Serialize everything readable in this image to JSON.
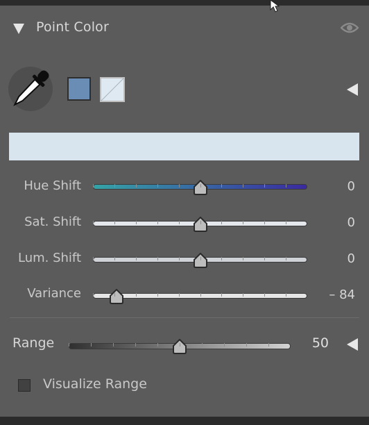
{
  "panel": {
    "title": "Point Color",
    "collapse_icon": "triangle-down-icon",
    "visibility_icon": "eye-icon"
  },
  "swatches": {
    "primary_color": "#6a8db5",
    "secondary_color": "#dfe9f1",
    "selected_color_bar": "#d9e5ee"
  },
  "sliders": [
    {
      "label": "Hue Shift",
      "value": "0",
      "fraction": 0.5,
      "track": "hue"
    },
    {
      "label": "Sat. Shift",
      "value": "0",
      "fraction": 0.5,
      "track": "sat"
    },
    {
      "label": "Lum. Shift",
      "value": "0",
      "fraction": 0.5,
      "track": "lum"
    },
    {
      "label": "Variance",
      "value": "– 84",
      "fraction": 0.11,
      "track": "var"
    }
  ],
  "range": {
    "label": "Range",
    "value": "50",
    "fraction": 0.5
  },
  "visualize": {
    "label": "Visualize Range",
    "checked": false
  },
  "colors": {
    "hue_start": "#35a3a6",
    "hue_end": "#3a2aa0",
    "sat_track": "#e4e8ec",
    "lum_track": "#cfd2d6",
    "var_track": "#e6e6e6",
    "range_start": "#303030",
    "range_end": "#d2d2d2"
  }
}
